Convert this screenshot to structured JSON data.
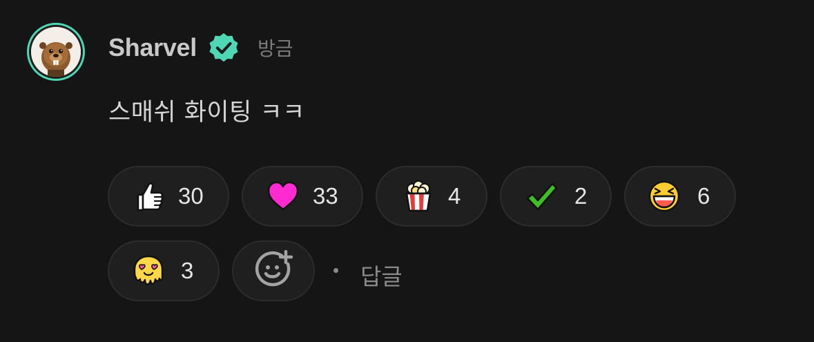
{
  "comment": {
    "author": "Sharvel",
    "verified": true,
    "time": "방금",
    "text": "스매쉬 화이팅 ㅋㅋ",
    "accent_color": "#4fd6b5",
    "avatar_icon": "beaver-avatar",
    "reactions": [
      {
        "emoji": "thumbs-up-icon",
        "count": "30"
      },
      {
        "emoji": "heart-icon",
        "count": "33"
      },
      {
        "emoji": "popcorn-icon",
        "count": "4"
      },
      {
        "emoji": "check-mark-icon",
        "count": "2"
      },
      {
        "emoji": "laughing-face-icon",
        "count": "6"
      },
      {
        "emoji": "heart-eyes-melting-face-icon",
        "count": "3"
      }
    ],
    "add_reaction_icon": "add-emoji-icon",
    "reply_label": "답글"
  }
}
